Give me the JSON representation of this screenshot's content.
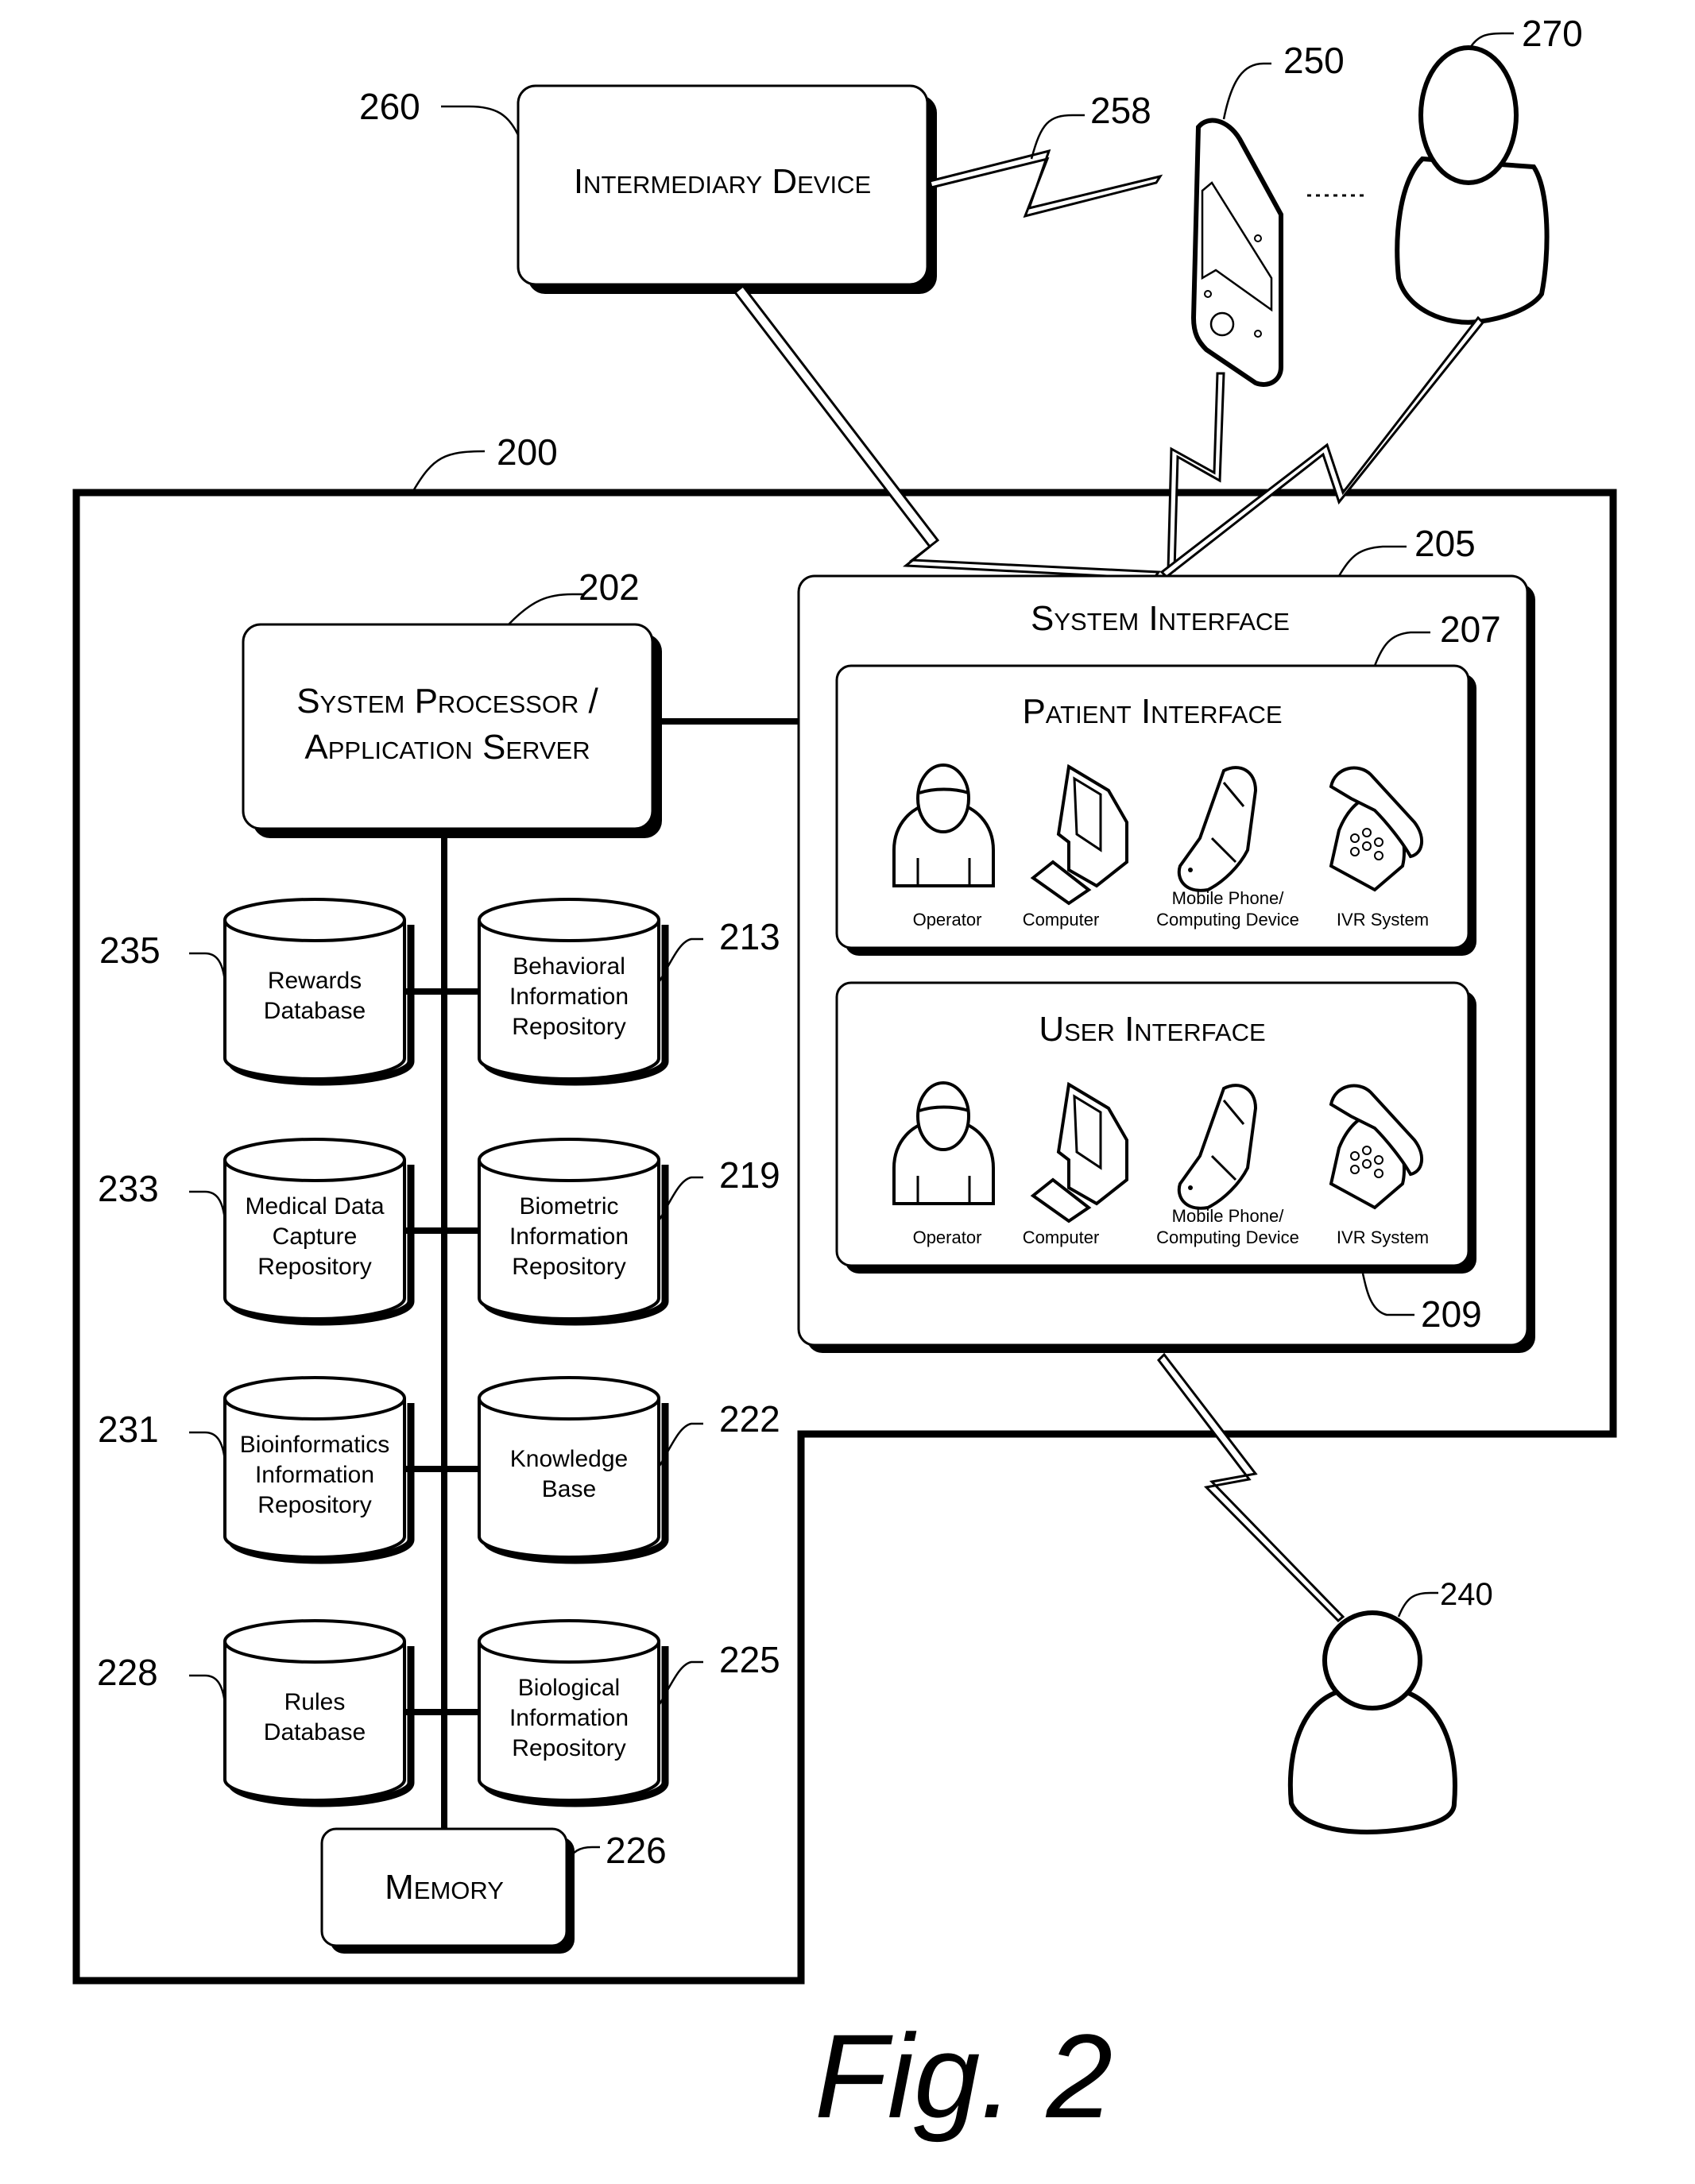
{
  "figure": {
    "caption": "Fig. 2",
    "system_ref": "200"
  },
  "intermediary_device": {
    "ref": "260",
    "label": "Intermediary Device"
  },
  "link_258": {
    "ref": "258"
  },
  "handheld_device": {
    "ref": "250"
  },
  "person_top": {
    "ref": "270"
  },
  "person_bottom": {
    "ref": "240"
  },
  "system_processor": {
    "ref": "202",
    "line1": "System Processor /",
    "line2": "Application Server"
  },
  "system_interface": {
    "ref": "205",
    "title": "System Interface",
    "patient_interface": {
      "ref": "207",
      "title": "Patient Interface",
      "items": [
        {
          "icon": "operator-icon",
          "label": "Operator"
        },
        {
          "icon": "computer-icon",
          "label": "Computer"
        },
        {
          "icon": "mobile-phone-icon",
          "label_line1": "Mobile Phone/",
          "label_line2": "Computing Device"
        },
        {
          "icon": "telephone-icon",
          "label": "IVR System"
        }
      ]
    },
    "user_interface": {
      "ref": "209",
      "title": "User Interface",
      "items": [
        {
          "icon": "operator-icon",
          "label": "Operator"
        },
        {
          "icon": "computer-icon",
          "label": "Computer"
        },
        {
          "icon": "mobile-phone-icon",
          "label_line1": "Mobile Phone/",
          "label_line2": "Computing Device"
        },
        {
          "icon": "telephone-icon",
          "label": "IVR System"
        }
      ]
    }
  },
  "databases": {
    "left": [
      {
        "ref": "235",
        "lines": [
          "Rewards",
          "Database"
        ]
      },
      {
        "ref": "233",
        "lines": [
          "Medical Data",
          "Capture",
          "Repository"
        ]
      },
      {
        "ref": "231",
        "lines": [
          "Bioinformatics",
          "Information",
          "Repository"
        ]
      },
      {
        "ref": "228",
        "lines": [
          "Rules",
          "Database"
        ]
      }
    ],
    "right": [
      {
        "ref": "213",
        "lines": [
          "Behavioral",
          "Information",
          "Repository"
        ]
      },
      {
        "ref": "219",
        "lines": [
          "Biometric",
          "Information",
          "Repository"
        ]
      },
      {
        "ref": "222",
        "lines": [
          "Knowledge",
          "Base"
        ]
      },
      {
        "ref": "225",
        "lines": [
          "Biological",
          "Information",
          "Repository"
        ]
      }
    ]
  },
  "memory": {
    "ref": "226",
    "label": "Memory"
  }
}
